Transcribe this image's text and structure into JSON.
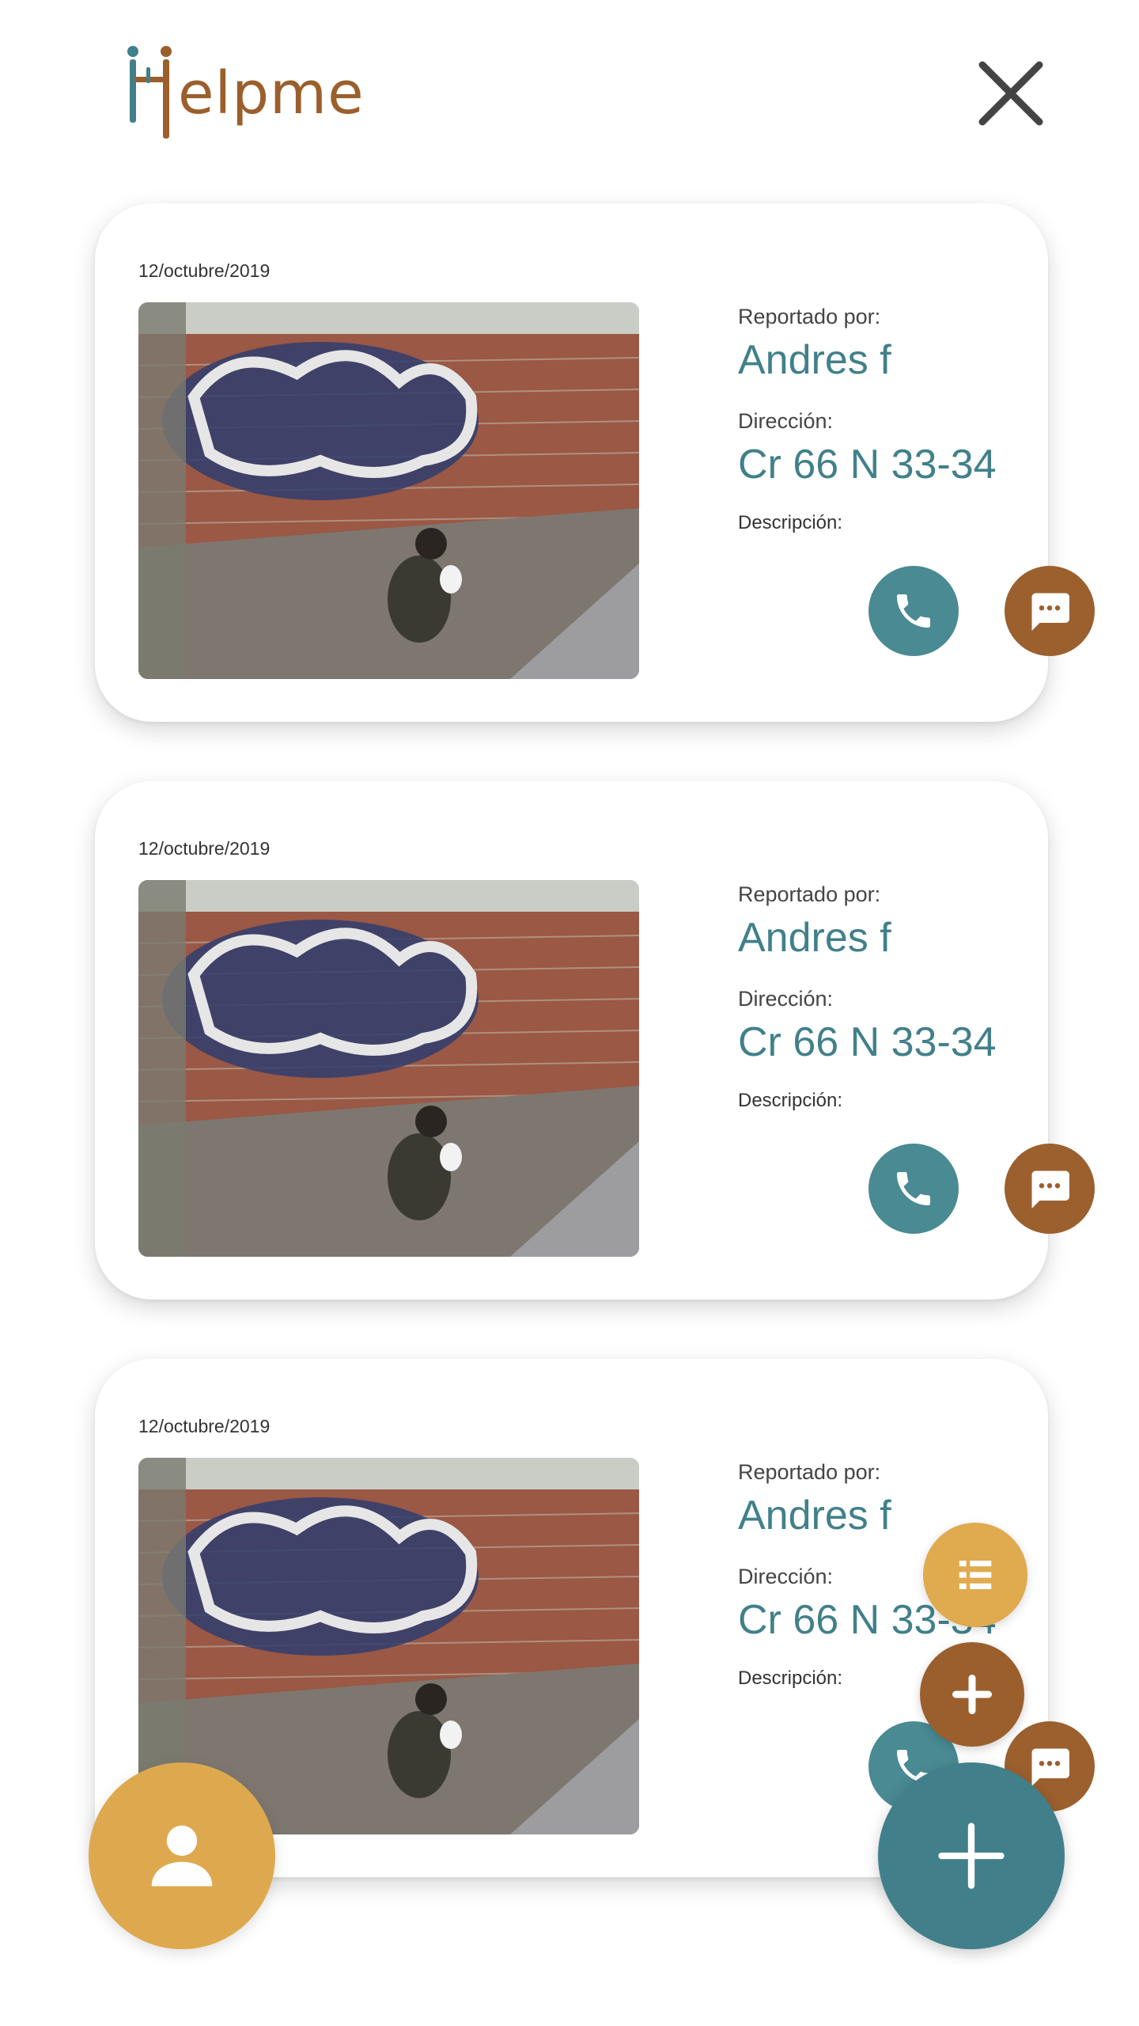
{
  "app": {
    "logo_text": "elpme"
  },
  "colors": {
    "teal": "#41808a",
    "brown": "#9b602e",
    "gold": "#dea94e"
  },
  "cards": [
    {
      "date": "12/octubre/2019",
      "reported_by_label": "Reportado por:",
      "reported_by": "Andres f",
      "address_label": "Dirección:",
      "address": "Cr 66 N 33-34",
      "description_label": "Descripción:"
    },
    {
      "date": "12/octubre/2019",
      "reported_by_label": "Reportado por:",
      "reported_by": "Andres f",
      "address_label": "Dirección:",
      "address": "Cr 66 N 33-34",
      "description_label": "Descripción:"
    },
    {
      "date": "12/octubre/2019",
      "reported_by_label": "Reportado por:",
      "reported_by": "Andres f",
      "address_label": "Dirección:",
      "address": "Cr 66 N 33-34",
      "description_label": "Descripción:"
    }
  ],
  "icons": {
    "close": "close-icon",
    "call": "phone-icon",
    "message": "chat-icon",
    "profile": "user-icon",
    "list": "list-icon",
    "add": "plus-icon"
  }
}
